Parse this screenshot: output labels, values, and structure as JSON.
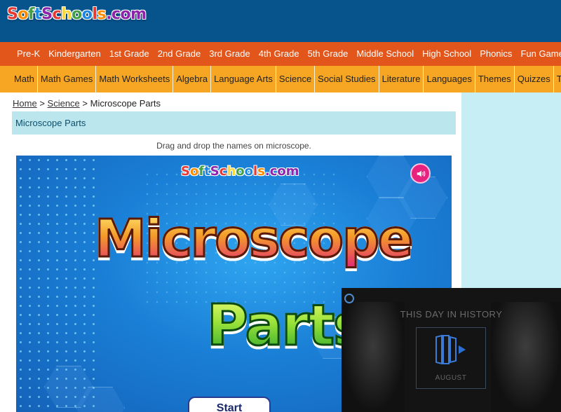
{
  "header": {
    "logo_text": "SoftSchools.com",
    "background": "#07538c"
  },
  "nav_primary": {
    "background": "#e2561c",
    "items": [
      "Pre-K",
      "Kindergarten",
      "1st Grade",
      "2nd Grade",
      "3rd Grade",
      "4th Grade",
      "5th Grade",
      "Middle School",
      "High School",
      "Phonics",
      "Fun Games"
    ]
  },
  "nav_secondary": {
    "background": "#f6a623",
    "items": [
      "Math",
      "Math Games",
      "Math Worksheets",
      "Algebra",
      "Language Arts",
      "Science",
      "Social Studies",
      "Literature",
      "Languages",
      "Themes",
      "Quizzes",
      "Timelines"
    ]
  },
  "breadcrumb": {
    "home": "Home",
    "sep1": ">",
    "science": "Science",
    "sep2": ">",
    "current": "Microscope Parts"
  },
  "page": {
    "title": "Microscope Parts",
    "instructions": "Drag and drop the names on microscope."
  },
  "game": {
    "logo_text": "SoftSchools.com",
    "sound_icon": "speaker-icon",
    "title_line1": "Microscope",
    "title_line2": "Parts",
    "start_label": "Start"
  },
  "video_ad": {
    "brand_icon": "brand-ring-icon",
    "heading": "THIS DAY IN HISTORY",
    "play_icon": "play-icon",
    "month": "AUGUST"
  }
}
